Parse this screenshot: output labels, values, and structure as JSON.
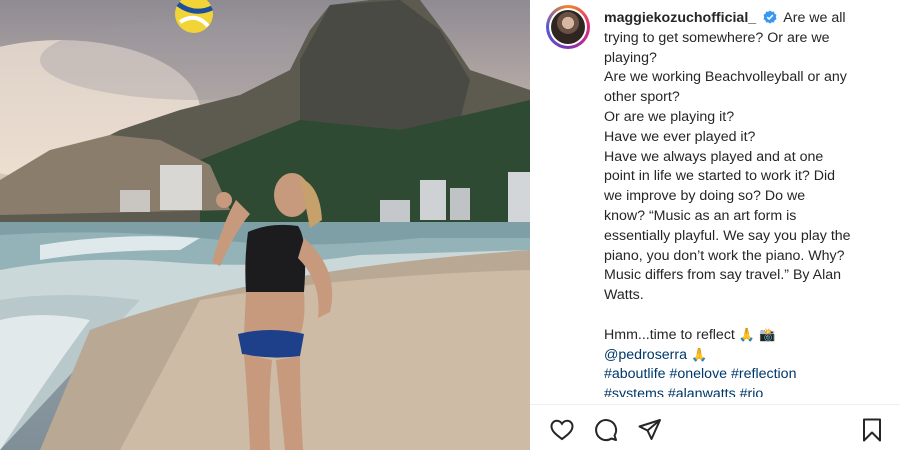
{
  "post": {
    "username": "maggiekozuchofficial_",
    "verified_icon": "verified-badge-icon",
    "caption_lines": [
      "Are we all",
      "trying to get somewhere? Or are we",
      "playing?",
      "Are we working Beachvolleyball or any",
      "other sport?",
      "Or are we playing it?",
      "Have we ever played it?",
      "Have we always played and at one",
      "point in life we started to work it? Did",
      "we improve by doing so? Do we",
      "know? “Music as an art form is",
      "essentially playful. We say you play the",
      "piano, you don’t work the piano. Why?",
      "Music differs from say travel.” By Alan",
      "Watts."
    ],
    "reflect_text": "Hmm...time to reflect",
    "reflect_emojis": "🙏 📸",
    "mention": "@pedroserra",
    "mention_emoji": "🙏",
    "hashtags_line1": "#aboutlife #onelove #reflection",
    "hashtags_line2": "#systems #alanwatts #rio"
  },
  "actions": {
    "like_icon": "heart-icon",
    "comment_icon": "comment-icon",
    "share_icon": "paper-plane-icon",
    "save_icon": "bookmark-icon"
  },
  "colors": {
    "text": "#262626",
    "link": "#00376b",
    "verified": "#3897f0"
  }
}
